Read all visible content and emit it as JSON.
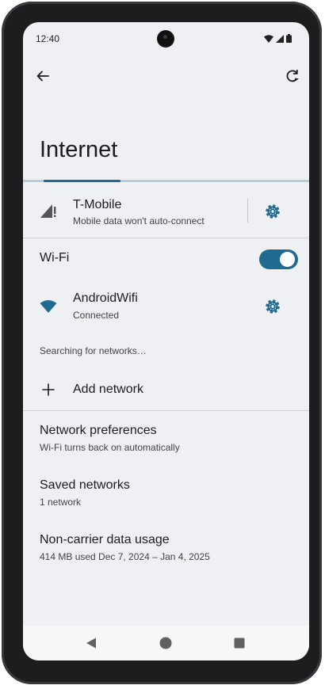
{
  "status_bar": {
    "time": "12:40"
  },
  "page": {
    "title": "Internet"
  },
  "carrier": {
    "name": "T-Mobile",
    "subtitle": "Mobile data won't auto-connect"
  },
  "wifi": {
    "label": "Wi-Fi",
    "enabled": true
  },
  "connected_network": {
    "name": "AndroidWifi",
    "status": "Connected"
  },
  "scanning": {
    "text": "Searching for networks…"
  },
  "add_network": {
    "label": "Add network"
  },
  "settings": [
    {
      "title": "Network preferences",
      "subtitle": "Wi-Fi turns back on automatically"
    },
    {
      "title": "Saved networks",
      "subtitle": "1 network"
    },
    {
      "title": "Non-carrier data usage",
      "subtitle": "414 MB used Dec 7, 2024 – Jan 4, 2025"
    }
  ],
  "colors": {
    "accent": "#1f6a8f",
    "background": "#eff0f4",
    "divider": "#cdced2"
  },
  "icons": {
    "back": "arrow-left-icon",
    "refresh": "refresh-icon",
    "signal": "signal-icon",
    "settings": "gear-icon",
    "wifi": "wifi-icon",
    "add": "plus-icon",
    "nav_back": "triangle-back-icon",
    "nav_home": "circle-home-icon",
    "nav_recents": "square-recents-icon"
  }
}
